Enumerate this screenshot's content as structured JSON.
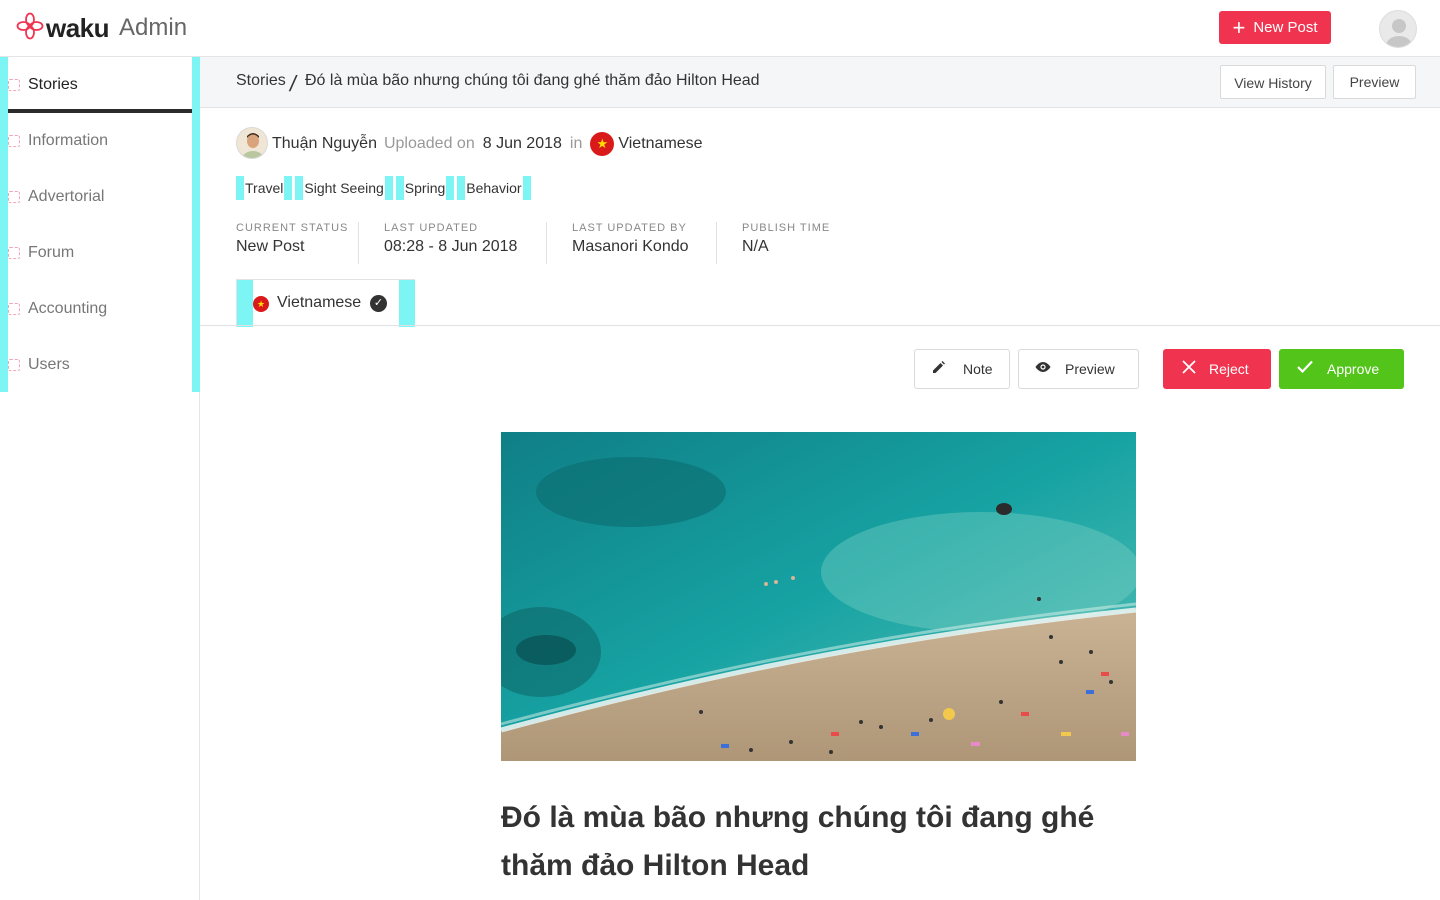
{
  "app": {
    "brand": "waku",
    "section": "Admin",
    "new_post_label": "New Post"
  },
  "sidebar": {
    "items": [
      {
        "label": "Stories",
        "active": true
      },
      {
        "label": "Information",
        "active": false
      },
      {
        "label": "Advertorial",
        "active": false
      },
      {
        "label": "Forum",
        "active": false
      },
      {
        "label": "Accounting",
        "active": false
      },
      {
        "label": "Users",
        "active": false
      }
    ]
  },
  "breadcrumb": {
    "root": "Stories",
    "separator": "/",
    "current": "Đó là mùa bão nhưng chúng tôi đang ghé thăm đảo Hilton Head",
    "view_history_label": "View History",
    "preview_label": "Preview"
  },
  "meta": {
    "author": "Thuận Nguyễn",
    "uploaded_on_label": "Uploaded on",
    "date": "8 Jun 2018",
    "in_label": "in",
    "language": "Vietnamese"
  },
  "tags": [
    "Travel",
    "Sight Seeing",
    "Spring",
    "Behavior"
  ],
  "status": {
    "current_status_label": "CURRENT STATUS",
    "current_status": "New Post",
    "last_updated_label": "LAST UPDATED",
    "last_updated": "08:28 - 8 Jun 2018",
    "last_updated_by_label": "LAST UPDATED BY",
    "last_updated_by": "Masanori Kondo",
    "publish_time_label": "PUBLISH TIME",
    "publish_time": "N/A"
  },
  "language_tab": {
    "label": "Vietnamese",
    "approved": true
  },
  "actions": {
    "note": "Note",
    "preview": "Preview",
    "reject": "Reject",
    "approve": "Approve"
  },
  "article": {
    "title": "Đó là mùa bão nhưng chúng tôi đang ghé thăm đảo Hilton Head"
  },
  "colors": {
    "brand_red": "#f0344f",
    "approve_green": "#52c41a",
    "guide_cyan": "#7ef5f5"
  },
  "icons": {
    "logo": "flower-logo-icon",
    "plus": "plus-icon",
    "sidebar_item": "dashed-square-icon",
    "flag": "vietnam-flag-icon",
    "check": "check-circle-icon",
    "note": "pencil-icon",
    "preview": "eye-icon",
    "reject": "close-icon",
    "approve": "check-icon"
  }
}
